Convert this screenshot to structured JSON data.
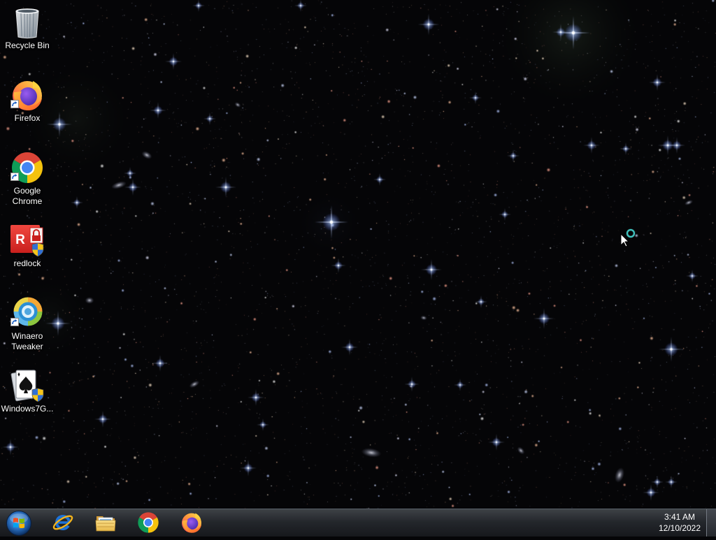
{
  "desktop": {
    "icons": [
      {
        "label": "Recycle Bin",
        "icon": "recycle-bin-icon",
        "shortcut": false
      },
      {
        "label": "Firefox",
        "icon": "firefox-icon",
        "shortcut": true
      },
      {
        "label": "Google Chrome",
        "icon": "chrome-icon",
        "shortcut": true
      },
      {
        "label": "redlock",
        "icon": "redlock-icon",
        "shortcut": false,
        "glyph": "R"
      },
      {
        "label": "Winaero Tweaker",
        "icon": "winaero-tweaker-icon",
        "shortcut": true
      },
      {
        "label": "Windows7G...",
        "icon": "solitaire-icon",
        "shortcut": false
      }
    ]
  },
  "taskbar": {
    "start_button": {
      "icon": "windows-start-orb-icon"
    },
    "pinned": [
      {
        "icon": "internet-explorer-icon"
      },
      {
        "icon": "file-explorer-icon"
      },
      {
        "icon": "chrome-icon"
      },
      {
        "icon": "firefox-icon"
      }
    ],
    "clock": {
      "time": "3:41 AM",
      "date": "12/10/2022"
    }
  },
  "cursor": {
    "icon": "busy-cursor-icon"
  },
  "colors": {
    "wallpaper": "#050507",
    "taskbar_top": "#2f3338",
    "taskbar_bottom": "#16181c",
    "label_text": "#ffffff",
    "busy_ring": "#3fc4c0"
  }
}
